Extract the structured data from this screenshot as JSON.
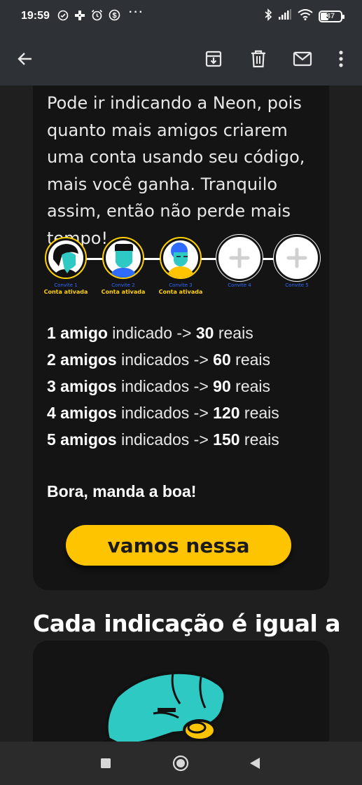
{
  "status_bar": {
    "time": "19:59",
    "overflow": "···",
    "battery": "37",
    "battery_level": 0.37,
    "left_icons": [
      "clock-outline-icon",
      "game-controller-icon",
      "alarm-icon",
      "dollar-coin-icon"
    ],
    "right_icons": [
      "bluetooth-icon",
      "cell-signal-icon",
      "wifi-icon",
      "battery-icon"
    ]
  },
  "app_bar": {
    "icons": [
      "back-arrow-icon",
      "archive-icon",
      "trash-icon",
      "mail-icon",
      "more-vertical-icon"
    ]
  },
  "email": {
    "intro": "Pode ir indicando a Neon, pois quanto mais amigos criarem uma conta usando seu código, mais você ganha. Tranquilo assim, então não perde mais tempo!",
    "steps": [
      {
        "label": "Convite 1",
        "status": "Conta ativada",
        "active": true
      },
      {
        "label": "Convite 2",
        "status": "Conta ativada",
        "active": true
      },
      {
        "label": "Convite 3",
        "status": "Conta ativada",
        "active": true
      },
      {
        "label": "Convite 4",
        "status": "",
        "active": false
      },
      {
        "label": "Convite 5",
        "status": "",
        "active": false
      }
    ],
    "rewards": [
      {
        "count": "1 amigo",
        "middle": " indicado -> ",
        "value": "30",
        "unit": " reais"
      },
      {
        "count": "2 amigos",
        "middle": " indicados -> ",
        "value": "60",
        "unit": " reais"
      },
      {
        "count": "3 amigos",
        "middle": " indicados -> ",
        "value": "90",
        "unit": " reais"
      },
      {
        "count": "4 amigos",
        "middle": " indicados -> ",
        "value": "120",
        "unit": " reais"
      },
      {
        "count": "5 amigos",
        "middle": " indicados -> ",
        "value": "150",
        "unit": " reais"
      }
    ],
    "cta_text": "Bora, manda a boa!",
    "cta_button": "vamos nessa",
    "section_title": "Cada indicação é igual a"
  },
  "colors": {
    "accent_yellow": "#ffc400",
    "link_blue": "#2f6bff",
    "bar_bg": "#2e3236",
    "card_bg": "#141414",
    "teal": "#2ec9c2"
  }
}
